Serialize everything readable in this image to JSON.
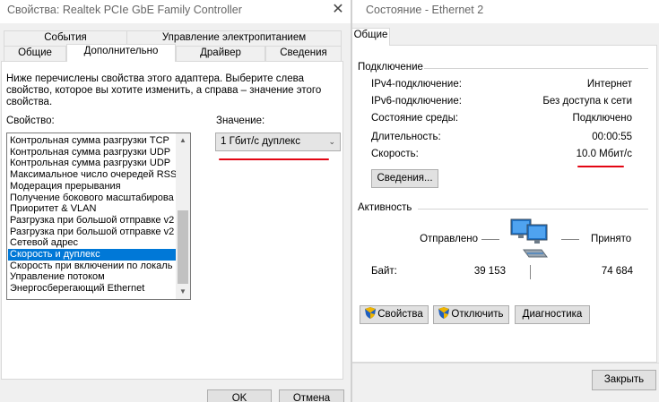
{
  "left_window": {
    "title": "Свойства: Realtek PCIe GbE Family Controller",
    "tabs_top": [
      "События",
      "Управление электропитанием"
    ],
    "tabs_bottom": [
      "Общие",
      "Дополнительно",
      "Драйвер",
      "Сведения"
    ],
    "active_tab": "Дополнительно",
    "description": [
      "Ниже перечислены свойства этого адаптера. Выберите слева",
      "свойство, которое вы хотите изменить, а справа – значение этого",
      "свойства."
    ],
    "property_label": "Свойство:",
    "value_label": "Значение:",
    "properties": [
      "Контрольная сумма разгрузки TCP",
      "Контрольная сумма разгрузки UDP",
      "Контрольная сумма разгрузки UDP",
      "Максимальное число очередей RSS",
      "Модерация прерывания",
      "Получение бокового масштабирова",
      "Приоритет & VLAN",
      "Разгрузка при большой отправке v2",
      "Разгрузка при большой отправке v2",
      "Сетевой адрес",
      "Скорость и дуплекс",
      "Скорость при включении по локаль",
      "Управление потоком",
      "Энергосберегающий Ethernet"
    ],
    "selected_property": "Скорость и дуплекс",
    "value_selected": "1 Гбит/с дуплекс",
    "ok_label": "OK",
    "cancel_label": "Отмена"
  },
  "right_window": {
    "title": "Состояние - Ethernet 2",
    "tab": "Общие",
    "connection_header": "Подключение",
    "rows": [
      {
        "label": "IPv4-подключение:",
        "value": "Интернет"
      },
      {
        "label": "IPv6-подключение:",
        "value": "Без доступа к сети"
      },
      {
        "label": "Состояние среды:",
        "value": "Подключено"
      },
      {
        "label": "Длительность:",
        "value": "00:00:55"
      },
      {
        "label": "Скорость:",
        "value": "10.0 Мбит/с"
      }
    ],
    "details_button": "Сведения...",
    "activity_header": "Активность",
    "sent_label": "Отправлено",
    "received_label": "Принято",
    "bytes_label": "Байт:",
    "bytes_sent": "39 153",
    "bytes_received": "74 684",
    "properties_button": "Свойства",
    "disable_button": "Отключить",
    "diagnostics_button": "Диагностика",
    "close_button": "Закрыть"
  },
  "colors": {
    "selection": "#0078d7",
    "annotation_red": "#e30613",
    "window_bg": "#f0f0f0"
  },
  "icons": [
    "close-icon",
    "chevron-down-icon",
    "shield-icon",
    "network-activity-icon"
  ]
}
